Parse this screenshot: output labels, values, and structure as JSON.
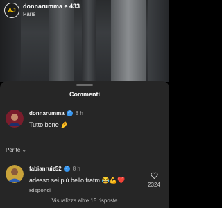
{
  "post": {
    "avatar_text": "AJ",
    "username": "donnarumma e 433",
    "location": "Paris"
  },
  "sheet": {
    "title": "Commenti"
  },
  "comments": [
    {
      "username": "donnarumma",
      "verified": true,
      "time": "8 h",
      "text": "Tutto bene 🤌"
    },
    {
      "username": "fabianruiz52",
      "verified": true,
      "time": "8 h",
      "text": "adesso sei più bello fratm 😂💪❤️",
      "reply_label": "Rispondi",
      "like_count": "2324"
    }
  ],
  "filter": {
    "label": "Per te",
    "chevron": "⌄"
  },
  "footer": {
    "view_more": "Visualizza altre 15 risposte"
  },
  "icons": {
    "verified": "check-badge-icon",
    "like": "heart-outline-icon"
  },
  "colors": {
    "sheet_bg": "#262626",
    "verified": "#3897f0",
    "muted_text": "#a8a8a8"
  }
}
